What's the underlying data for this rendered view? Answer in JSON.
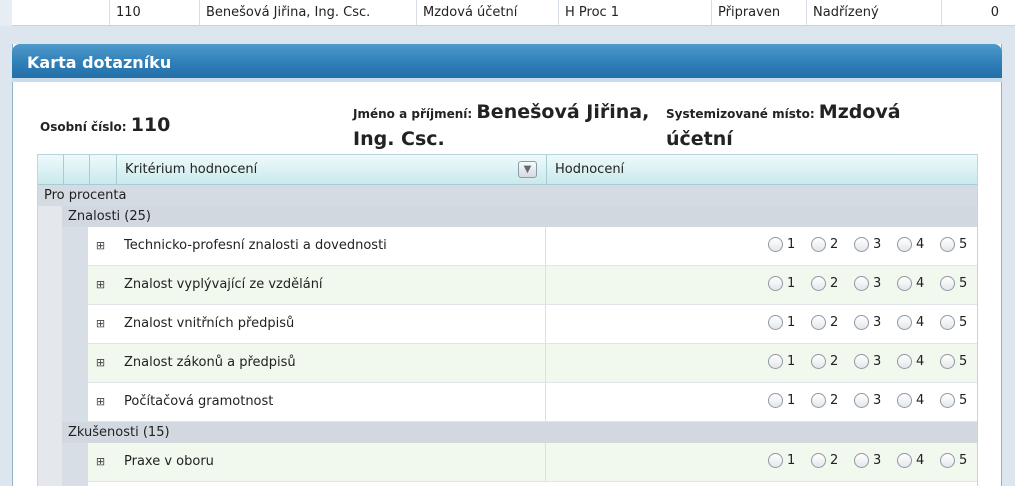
{
  "top_row": {
    "id": "110",
    "name": "Benešová Jiřina, Ing. Csc.",
    "position": "Mzdová účetní",
    "process": "H Proc 1",
    "state": "Připraven",
    "role": "Nadřízený",
    "count": "0"
  },
  "panel": {
    "title": "Karta dotazníku",
    "personal_number_label": "Osobní číslo:",
    "personal_number": "110",
    "name_label": "Jméno a příjmení:",
    "name_line1": "Benešová Jiřina,",
    "name_line2": "Ing. Csc.",
    "position_label": "Systemizované místo:",
    "position_line1": "Mzdová",
    "position_line2": "účetní"
  },
  "table": {
    "columns": [
      "Kritérium hodnocení",
      "Hodnocení"
    ],
    "sort_icon": "sort-down-icon",
    "group": "Pro procenta",
    "sections": [
      {
        "label": "Znalosti (25)",
        "items": [
          "Technicko-profesní znalosti a dovednosti",
          "Znalost vyplývající ze vzdělání",
          "Znalost vnitřních předpisů",
          "Znalost zákonů a předpisů",
          "Počítačová gramotnost"
        ]
      },
      {
        "label": "Zkušenosti (15)",
        "items": [
          "Praxe v oboru"
        ]
      }
    ],
    "scale": [
      "1",
      "2",
      "3",
      "4",
      "5"
    ],
    "expand_icon": "⊞"
  }
}
